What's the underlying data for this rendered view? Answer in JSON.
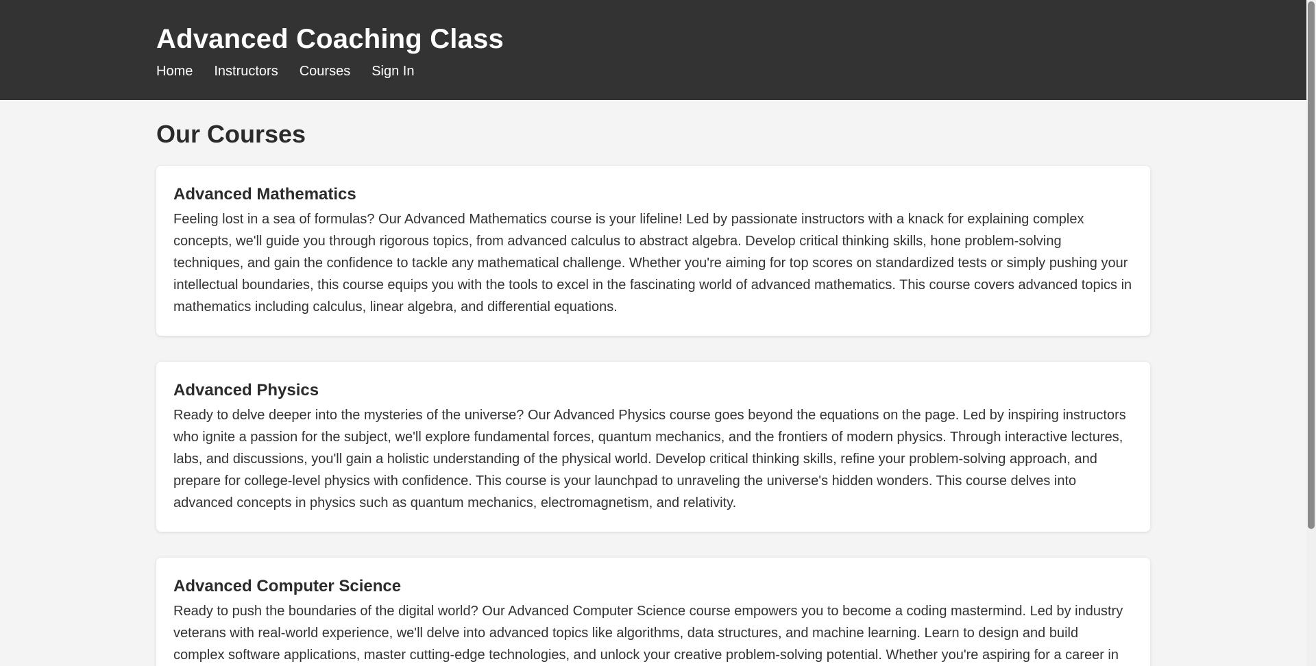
{
  "header": {
    "title": "Advanced Coaching Class",
    "nav": [
      {
        "label": "Home"
      },
      {
        "label": "Instructors"
      },
      {
        "label": "Courses"
      },
      {
        "label": "Sign In"
      }
    ]
  },
  "main": {
    "heading": "Our Courses",
    "courses": [
      {
        "title": "Advanced Mathematics",
        "description": "Feeling lost in a sea of formulas? Our Advanced Mathematics course is your lifeline! Led by passionate instructors with a knack for explaining complex concepts, we'll guide you through rigorous topics, from advanced calculus to abstract algebra. Develop critical thinking skills, hone problem-solving techniques, and gain the confidence to tackle any mathematical challenge. Whether you're aiming for top scores on standardized tests or simply pushing your intellectual boundaries, this course equips you with the tools to excel in the fascinating world of advanced mathematics. This course covers advanced topics in mathematics including calculus, linear algebra, and differential equations."
      },
      {
        "title": "Advanced Physics",
        "description": "Ready to delve deeper into the mysteries of the universe? Our Advanced Physics course goes beyond the equations on the page. Led by inspiring instructors who ignite a passion for the subject, we'll explore fundamental forces, quantum mechanics, and the frontiers of modern physics. Through interactive lectures, labs, and discussions, you'll gain a holistic understanding of the physical world. Develop critical thinking skills, refine your problem-solving approach, and prepare for college-level physics with confidence. This course is your launchpad to unraveling the universe's hidden wonders. This course delves into advanced concepts in physics such as quantum mechanics, electromagnetism, and relativity."
      },
      {
        "title": "Advanced Computer Science",
        "description": "Ready to push the boundaries of the digital world? Our Advanced Computer Science course empowers you to become a coding mastermind. Led by industry veterans with real-world experience, we'll delve into advanced topics like algorithms, data structures, and machine learning. Learn to design and build complex software applications, master cutting-edge technologies, and unlock your creative problem-solving potential. Whether you're aspiring for a career in"
      }
    ]
  },
  "colors": {
    "header_bg": "#333333",
    "page_bg": "#f4f4f4",
    "card_bg": "#ffffff",
    "text": "#333333"
  }
}
